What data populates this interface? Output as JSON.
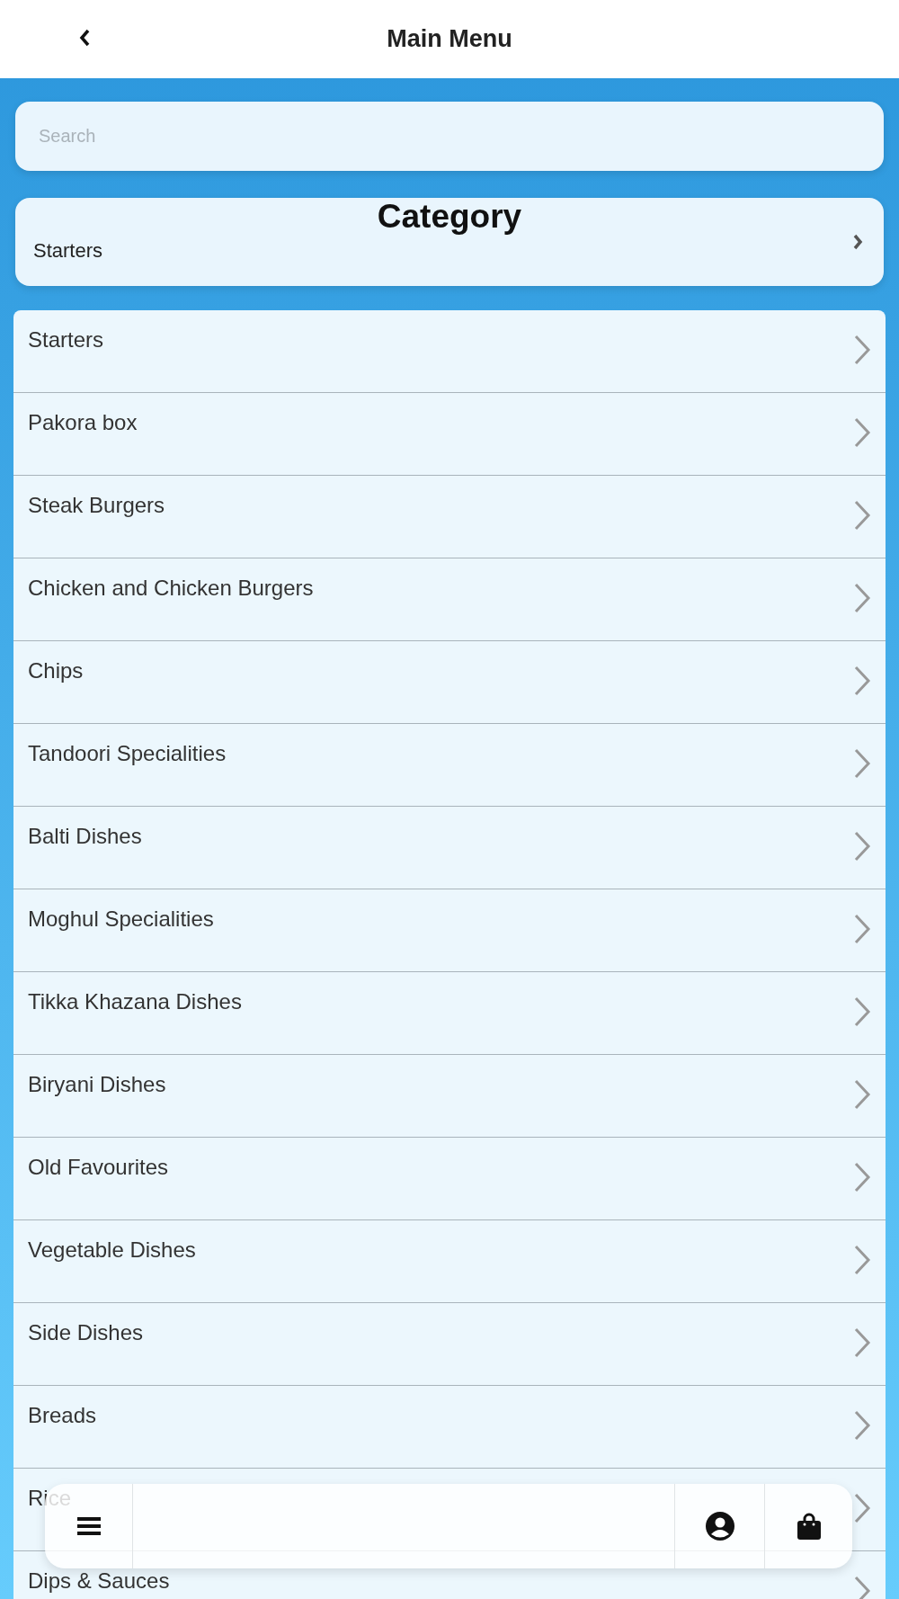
{
  "header": {
    "title": "Main Menu"
  },
  "search": {
    "placeholder": "Search"
  },
  "category": {
    "title": "Category",
    "value": "Starters"
  },
  "categories": [
    {
      "label": "Starters"
    },
    {
      "label": "Pakora box"
    },
    {
      "label": "Steak Burgers"
    },
    {
      "label": "Chicken and Chicken Burgers"
    },
    {
      "label": "Chips"
    },
    {
      "label": "Tandoori Specialities"
    },
    {
      "label": "Balti Dishes"
    },
    {
      "label": "Moghul Specialities"
    },
    {
      "label": "Tikka Khazana Dishes"
    },
    {
      "label": "Biryani Dishes"
    },
    {
      "label": "Old Favourites"
    },
    {
      "label": "Vegetable Dishes"
    },
    {
      "label": "Side Dishes"
    },
    {
      "label": "Breads"
    },
    {
      "label": "Rice"
    },
    {
      "label": "Dips & Sauces"
    }
  ]
}
